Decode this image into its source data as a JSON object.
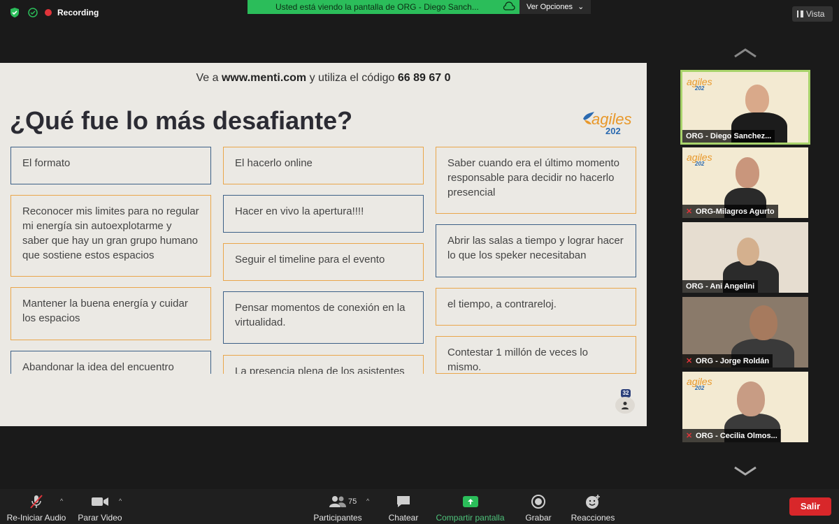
{
  "top": {
    "recording_label": "Recording",
    "share_banner": "Usted está viendo la pantalla de ORG - Diego Sanch...",
    "view_options": "Ver Opciones",
    "view_button": "Vista"
  },
  "slide": {
    "instruction_prefix": "Ve a ",
    "instruction_url": "www.menti.com",
    "instruction_mid": " y utiliza el código ",
    "instruction_code": "66 89 67 0",
    "title": "¿Qué fue lo más desafiante?",
    "logo_text": "agiles",
    "logo_year": "202",
    "participant_count": "32",
    "cards": [
      {
        "text": "El formato",
        "color": "blue"
      },
      {
        "text": "Reconocer mis limites para no regular mi energía sin autoexplotarme y saber que hay un gran grupo humano que sostiene estos espacios",
        "color": "orange"
      },
      {
        "text": "Mantener la buena energía y cuidar los espacios",
        "color": "orange"
      },
      {
        "text": "Abandonar la idea del encuentro",
        "color": "blue"
      },
      {
        "text": "El hacerlo online",
        "color": "orange"
      },
      {
        "text": "Hacer en vivo la apertura!!!!",
        "color": "blue"
      },
      {
        "text": "Seguir el timeline para el evento",
        "color": "orange"
      },
      {
        "text": "Pensar momentos de conexión en la virtualidad.",
        "color": "blue"
      },
      {
        "text": "La presencia plena de los asistentes",
        "color": "orange"
      },
      {
        "text": "Saber cuando era el último momento responsable para decidir no hacerlo presencial",
        "color": "orange"
      },
      {
        "text": "Abrir las salas a tiempo y lograr hacer lo que los speker necesitaban",
        "color": "blue"
      },
      {
        "text": "el tiempo, a contrareloj.",
        "color": "orange"
      },
      {
        "text": "Contestar 1 millón de veces lo mismo.",
        "color": "orange"
      }
    ]
  },
  "participants": [
    {
      "name": "ORG - Diego Sanchez...",
      "muted": false,
      "active": true
    },
    {
      "name": "ORG-Milagros Agurto",
      "muted": true,
      "active": false
    },
    {
      "name": "ORG - Ani Angelini",
      "muted": false,
      "active": false
    },
    {
      "name": "ORG - Jorge Roldán",
      "muted": true,
      "active": false
    },
    {
      "name": "ORG - Cecilia Olmos...",
      "muted": true,
      "active": false
    }
  ],
  "toolbar": {
    "audio_label": "Re-Iniciar Audio",
    "video_label": "Parar Video",
    "participants_label": "Participantes",
    "participants_count": "75",
    "chat_label": "Chatear",
    "share_label": "Compartir pantalla",
    "record_label": "Grabar",
    "reactions_label": "Reacciones",
    "leave_label": "Salir"
  },
  "colors": {
    "accent_green": "#2bbd5a",
    "leave_red": "#d8272a",
    "card_blue": "#3b5f86",
    "card_orange": "#e9a64a"
  }
}
